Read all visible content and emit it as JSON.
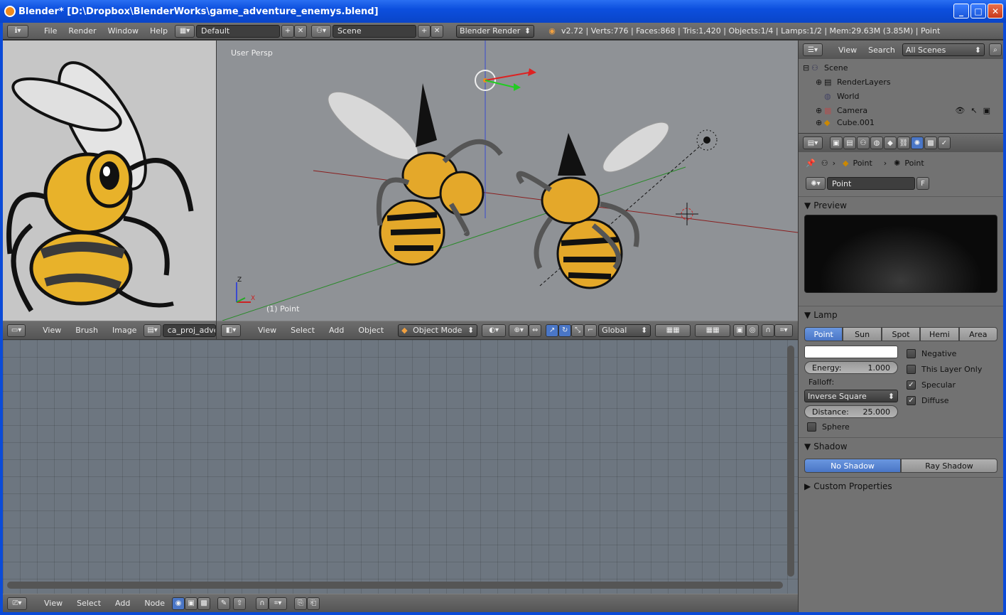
{
  "window": {
    "title": "Blender* [D:\\Dropbox\\BlenderWorks\\game_adventure_enemys.blend]"
  },
  "info": {
    "menus": [
      "File",
      "Render",
      "Window",
      "Help"
    ],
    "layout": "Default",
    "scene": "Scene",
    "engine": "Blender Render",
    "stats": "v2.72 | Verts:776 | Faces:868 | Tris:1,420 | Objects:1/4 | Lamps:1/2 | Mem:29.63M (3.85M) | Point"
  },
  "image_editor": {
    "menus": [
      "View",
      "Brush",
      "Image"
    ],
    "image_name": "ca_proj_advent"
  },
  "viewport": {
    "label": "User Persp",
    "object_label": "(1) Point",
    "menus": [
      "View",
      "Select",
      "Add",
      "Object"
    ],
    "mode": "Object Mode",
    "orientation": "Global",
    "axis_z": "Z",
    "axis_x": "X"
  },
  "node_editor": {
    "menus": [
      "View",
      "Select",
      "Add",
      "Node"
    ]
  },
  "outliner": {
    "menus": [
      "View",
      "Search"
    ],
    "filter": "All Scenes",
    "items": [
      {
        "label": "Scene",
        "indent": 0
      },
      {
        "label": "RenderLayers",
        "indent": 1
      },
      {
        "label": "World",
        "indent": 1
      },
      {
        "label": "Camera",
        "indent": 1
      },
      {
        "label": "Cube.001",
        "indent": 1
      }
    ]
  },
  "properties": {
    "breadcrumb_1": "Point",
    "breadcrumb_2": "Point",
    "datablock_name": "Point",
    "fake_user": "F",
    "preview_title": "Preview",
    "lamp_title": "Lamp",
    "lamp_types": [
      "Point",
      "Sun",
      "Spot",
      "Hemi",
      "Area"
    ],
    "energy_label": "Energy:",
    "energy_value": "1.000",
    "falloff_label": "Falloff:",
    "falloff_value": "Inverse Square",
    "distance_label": "Distance:",
    "distance_value": "25.000",
    "sphere_label": "Sphere",
    "negative_label": "Negative",
    "this_layer_only_label": "This Layer Only",
    "specular_label": "Specular",
    "diffuse_label": "Diffuse",
    "shadow_title": "Shadow",
    "shadow_types": [
      "No Shadow",
      "Ray Shadow"
    ],
    "custom_properties_title": "Custom Properties"
  }
}
